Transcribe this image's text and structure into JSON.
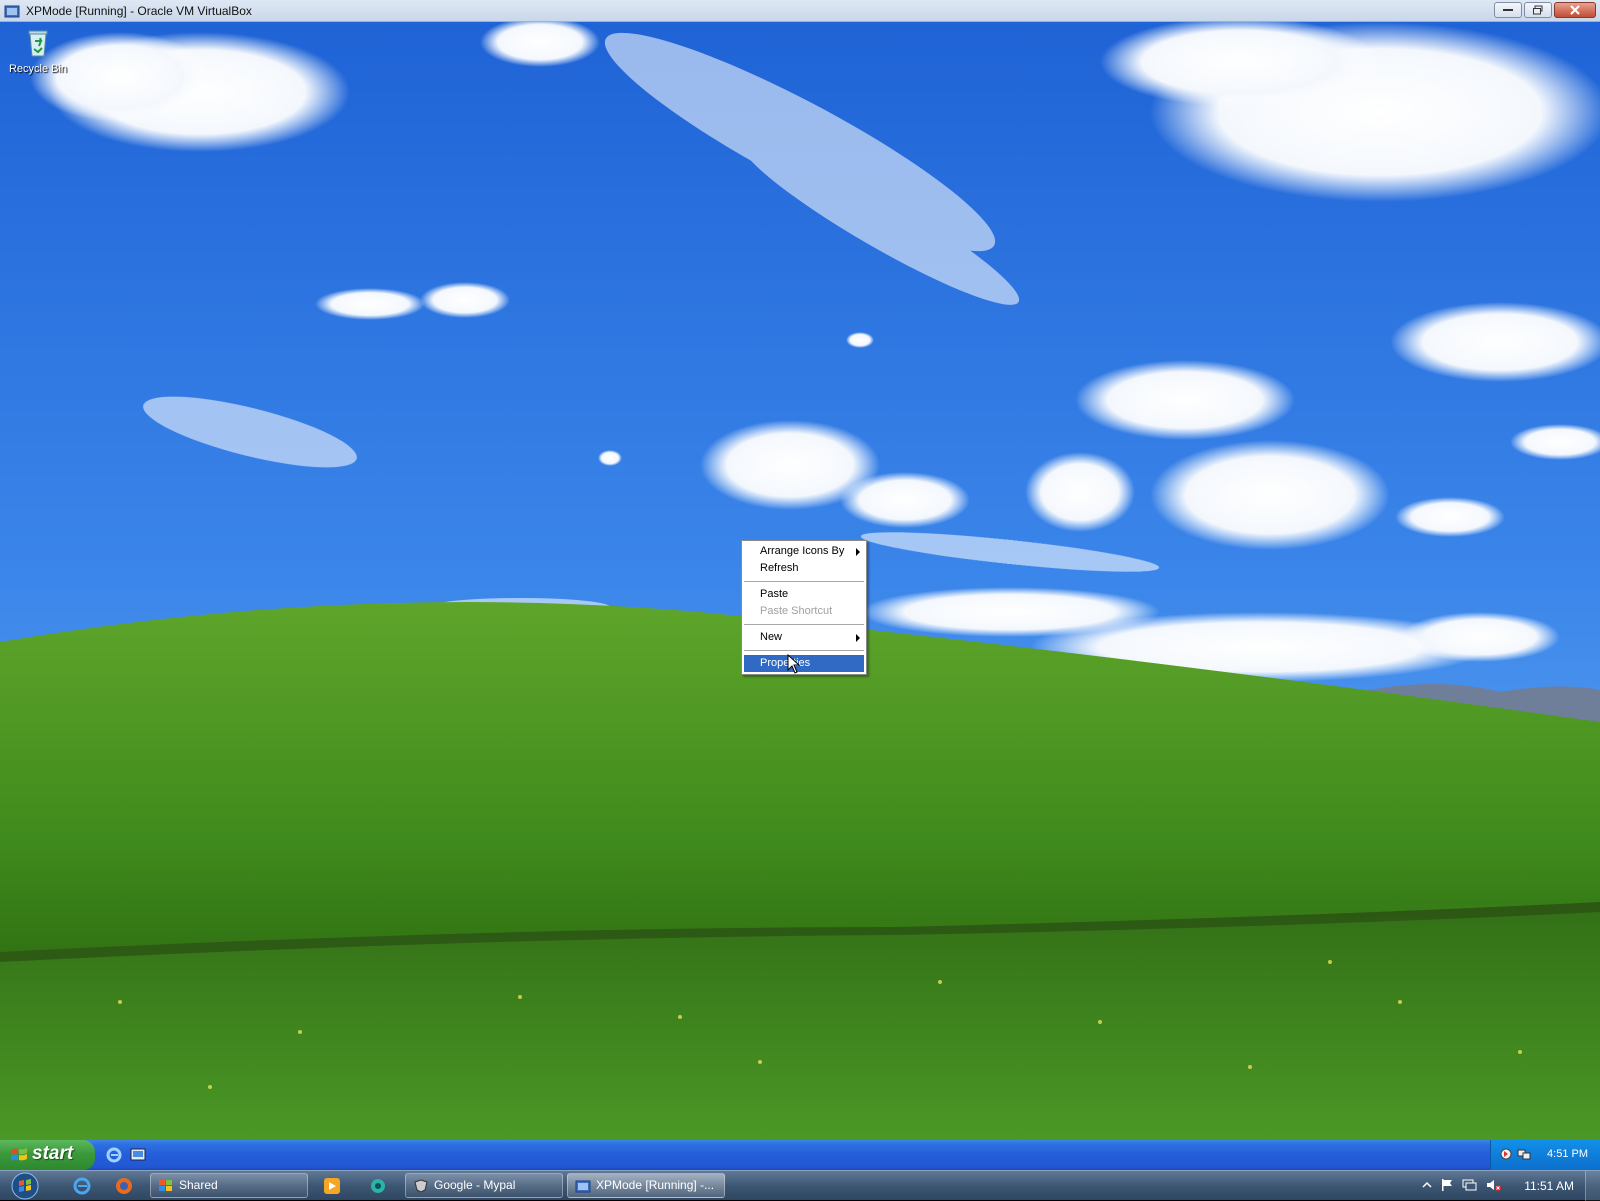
{
  "host_window": {
    "title": "XPMode [Running] - Oracle VM VirtualBox"
  },
  "desktop": {
    "icons": [
      {
        "label": "Recycle Bin"
      }
    ]
  },
  "context_menu": {
    "items": [
      {
        "label": "Arrange Icons By",
        "submenu": true
      },
      {
        "label": "Refresh"
      },
      {
        "label": "Paste"
      },
      {
        "label": "Paste Shortcut",
        "disabled": true
      },
      {
        "label": "New",
        "submenu": true
      },
      {
        "label": "Properties",
        "selected": true
      }
    ]
  },
  "xp_taskbar": {
    "start_label": "start",
    "clock": "4:51 PM"
  },
  "host_taskbar": {
    "tasks": [
      {
        "label": "Shared"
      },
      {
        "label": "Google - Mypal"
      },
      {
        "label": "XPMode [Running] -..."
      }
    ],
    "clock": "11:51 AM"
  },
  "colors": {
    "xp_taskbar_blue": "#245edb",
    "xp_start_green": "#3c9a3c",
    "menu_highlight": "#316ac5",
    "host_taskbar": "#3d5774"
  }
}
